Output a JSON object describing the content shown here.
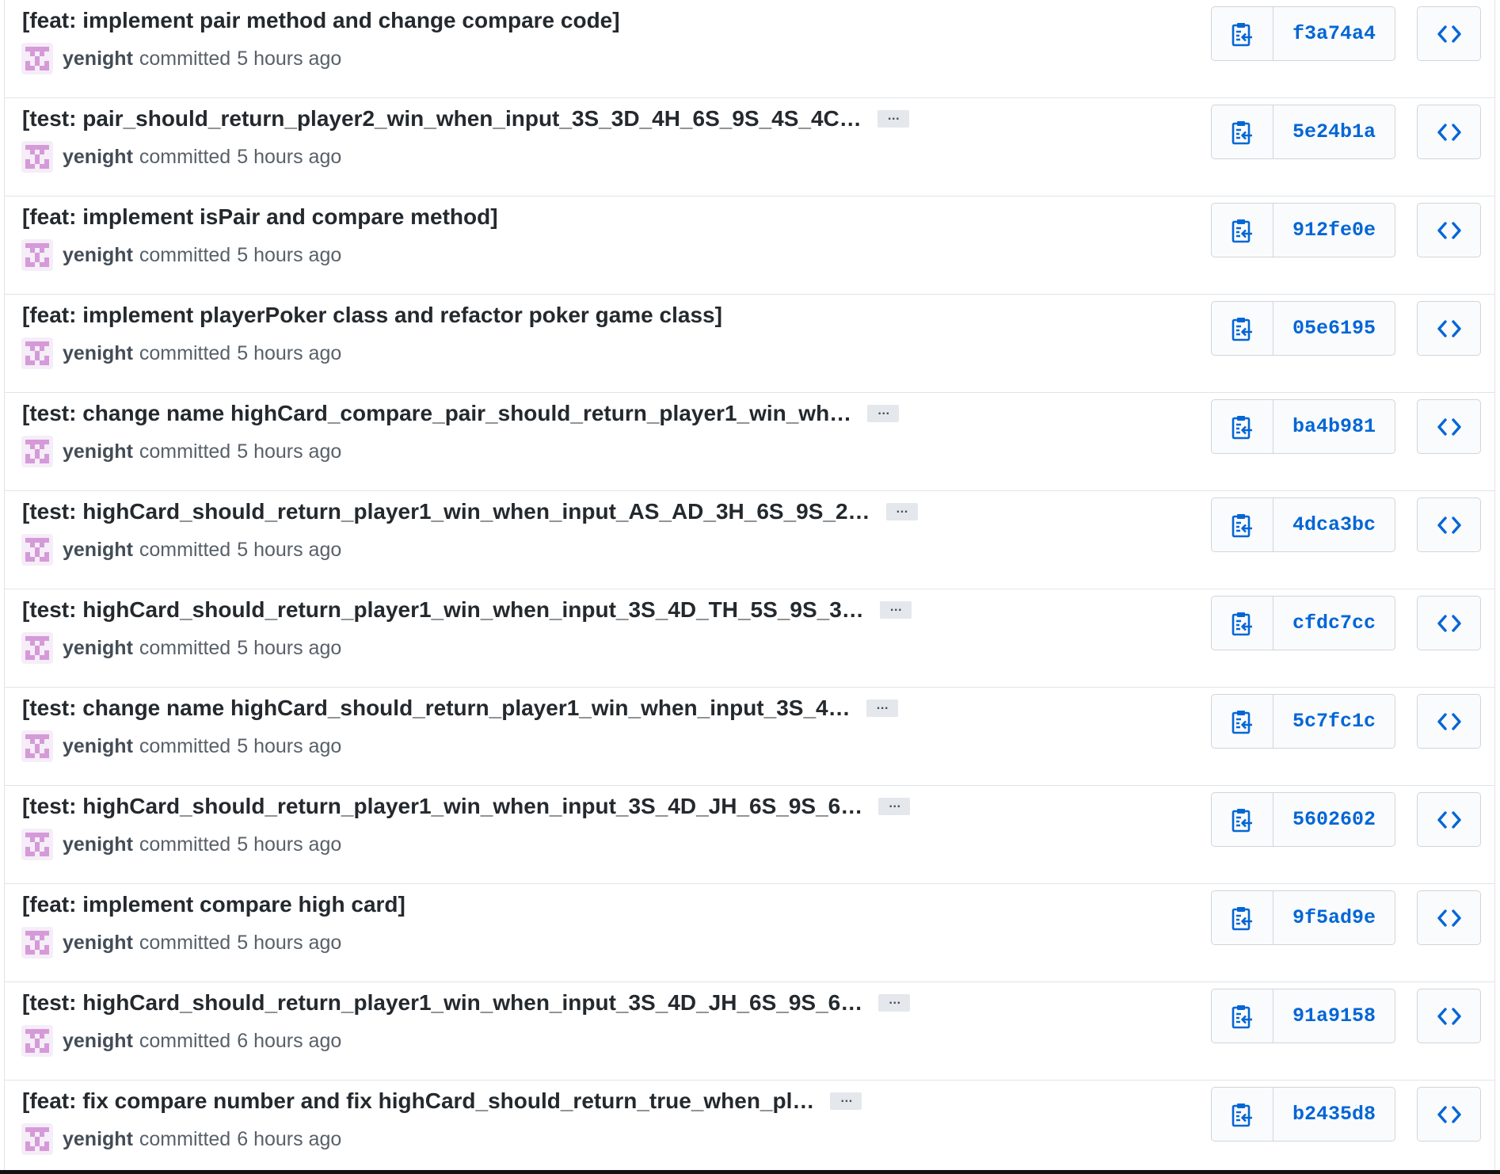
{
  "colors": {
    "title": "#24292e",
    "meta": "#586069",
    "sha": "#0366d6",
    "border": "#e1e4e8",
    "avatar": "#d59ad8"
  },
  "icons": {
    "copy": "clipboard-copy-icon",
    "browse": "code-icon",
    "more": "kebab-ellipsis-icon"
  },
  "labels": {
    "committed": "committed",
    "ellipsis": "…"
  },
  "commits": [
    {
      "title": "[feat: implement pair method and change compare code]",
      "truncated": false,
      "author": "yenight",
      "time": "5 hours ago",
      "sha": "f3a74a4"
    },
    {
      "title": "[test: pair_should_return_player2_win_when_input_3S_3D_4H_6S_9S_4S_4C…",
      "truncated": true,
      "author": "yenight",
      "time": "5 hours ago",
      "sha": "5e24b1a"
    },
    {
      "title": "[feat: implement isPair and compare method]",
      "truncated": false,
      "author": "yenight",
      "time": "5 hours ago",
      "sha": "912fe0e"
    },
    {
      "title": "[feat: implement playerPoker class and refactor poker game class]",
      "truncated": false,
      "author": "yenight",
      "time": "5 hours ago",
      "sha": "05e6195"
    },
    {
      "title": "[test: change name highCard_compare_pair_should_return_player1_win_wh…",
      "truncated": true,
      "author": "yenight",
      "time": "5 hours ago",
      "sha": "ba4b981"
    },
    {
      "title": "[test: highCard_should_return_player1_win_when_input_AS_AD_3H_6S_9S_2…",
      "truncated": true,
      "author": "yenight",
      "time": "5 hours ago",
      "sha": "4dca3bc"
    },
    {
      "title": "[test: highCard_should_return_player1_win_when_input_3S_4D_TH_5S_9S_3…",
      "truncated": true,
      "author": "yenight",
      "time": "5 hours ago",
      "sha": "cfdc7cc"
    },
    {
      "title": "[test: change name highCard_should_return_player1_win_when_input_3S_4…",
      "truncated": true,
      "author": "yenight",
      "time": "5 hours ago",
      "sha": "5c7fc1c"
    },
    {
      "title": "[test: highCard_should_return_player1_win_when_input_3S_4D_JH_6S_9S_6…",
      "truncated": true,
      "author": "yenight",
      "time": "5 hours ago",
      "sha": "5602602"
    },
    {
      "title": "[feat: implement compare high card]",
      "truncated": false,
      "author": "yenight",
      "time": "5 hours ago",
      "sha": "9f5ad9e"
    },
    {
      "title": "[test: highCard_should_return_player1_win_when_input_3S_4D_JH_6S_9S_6…",
      "truncated": true,
      "author": "yenight",
      "time": "6 hours ago",
      "sha": "91a9158"
    },
    {
      "title": "[feat: fix compare number and fix highCard_should_return_true_when_pl…",
      "truncated": true,
      "author": "yenight",
      "time": "6 hours ago",
      "sha": "b2435d8"
    }
  ]
}
